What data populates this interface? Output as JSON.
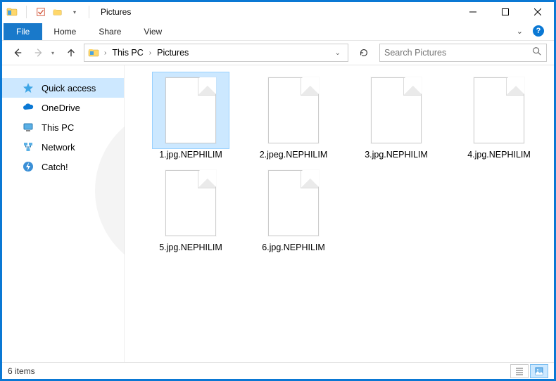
{
  "titlebar": {
    "title": "Pictures"
  },
  "ribbon": {
    "tabs": [
      "File",
      "Home",
      "Share",
      "View"
    ]
  },
  "address": {
    "crumbs": [
      "This PC",
      "Pictures"
    ]
  },
  "search": {
    "placeholder": "Search Pictures"
  },
  "sidebar": {
    "items": [
      {
        "label": "Quick access",
        "icon": "star-icon"
      },
      {
        "label": "OneDrive",
        "icon": "cloud-icon"
      },
      {
        "label": "This PC",
        "icon": "computer-icon"
      },
      {
        "label": "Network",
        "icon": "network-icon"
      },
      {
        "label": "Catch!",
        "icon": "bolt-icon"
      }
    ]
  },
  "files": [
    {
      "name": "1.jpg.NEPHILIM",
      "selected": true
    },
    {
      "name": "2.jpeg.NEPHILIM",
      "selected": false
    },
    {
      "name": "3.jpg.NEPHILIM",
      "selected": false
    },
    {
      "name": "4.jpg.NEPHILIM",
      "selected": false
    },
    {
      "name": "5.jpg.NEPHILIM",
      "selected": false
    },
    {
      "name": "6.jpg.NEPHILIM",
      "selected": false
    }
  ],
  "status": {
    "item_count": "6 items"
  },
  "colors": {
    "accent": "#0a78d4",
    "selection": "#cce8ff"
  }
}
